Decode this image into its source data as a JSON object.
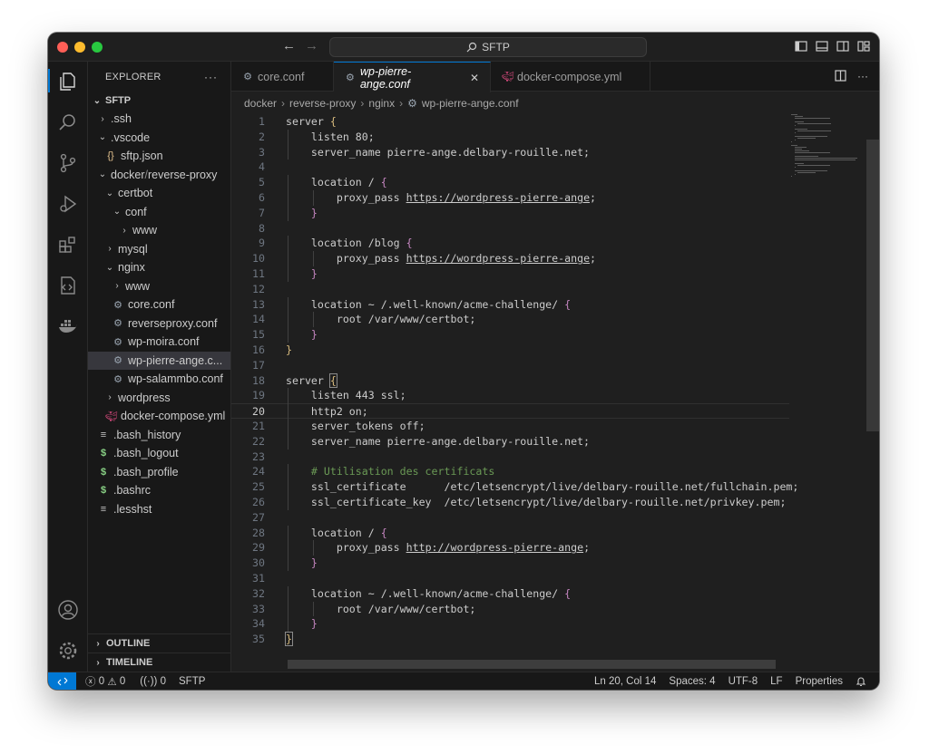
{
  "titlebar": {
    "search_text": "SFTP"
  },
  "explorer": {
    "header": "EXPLORER",
    "more": "···",
    "root": "SFTP",
    "items": [
      {
        "label": ".ssh",
        "kind": "folder",
        "open": false,
        "depth": 1
      },
      {
        "label": ".vscode",
        "kind": "folder",
        "open": true,
        "depth": 1
      },
      {
        "label": "sftp.json",
        "kind": "json",
        "depth": 2
      },
      {
        "label": "docker",
        "label2": "reverse-proxy",
        "kind": "folder",
        "open": true,
        "depth": 1
      },
      {
        "label": "certbot",
        "kind": "folder",
        "open": true,
        "depth": 2
      },
      {
        "label": "conf",
        "kind": "folder",
        "open": true,
        "depth": 3
      },
      {
        "label": "www",
        "kind": "folder",
        "open": false,
        "depth": 4
      },
      {
        "label": "mysql",
        "kind": "folder",
        "open": false,
        "depth": 2
      },
      {
        "label": "nginx",
        "kind": "folder",
        "open": true,
        "depth": 2
      },
      {
        "label": "www",
        "kind": "folder",
        "open": false,
        "depth": 3
      },
      {
        "label": "core.conf",
        "kind": "conf",
        "depth": 3
      },
      {
        "label": "reverseproxy.conf",
        "kind": "conf",
        "depth": 3
      },
      {
        "label": "wp-moira.conf",
        "kind": "conf",
        "depth": 3
      },
      {
        "label": "wp-pierre-ange.c...",
        "kind": "conf",
        "depth": 3,
        "selected": true
      },
      {
        "label": "wp-salammbo.conf",
        "kind": "conf",
        "depth": 3
      },
      {
        "label": "wordpress",
        "kind": "folder",
        "open": false,
        "depth": 2
      },
      {
        "label": "docker-compose.yml",
        "kind": "docker",
        "depth": 2
      },
      {
        "label": ".bash_history",
        "kind": "text",
        "depth": 1
      },
      {
        "label": ".bash_logout",
        "kind": "shell",
        "depth": 1
      },
      {
        "label": ".bash_profile",
        "kind": "shell",
        "depth": 1
      },
      {
        "label": ".bashrc",
        "kind": "shell",
        "depth": 1
      },
      {
        "label": ".lesshst",
        "kind": "text",
        "depth": 1
      }
    ],
    "outline": "OUTLINE",
    "timeline": "TIMELINE"
  },
  "tabs": [
    {
      "label": "core.conf",
      "icon": "gear-icon",
      "active": false
    },
    {
      "label": "wp-pierre-ange.conf",
      "icon": "gear-icon",
      "active": true,
      "close": "✕"
    },
    {
      "label": "docker-compose.yml",
      "icon": "docker-icon",
      "active": false
    }
  ],
  "breadcrumb": [
    "docker",
    "reverse-proxy",
    "nginx",
    "wp-pierre-ange.conf"
  ],
  "code": {
    "current_line": 20,
    "lines": [
      "server {",
      "    listen 80;",
      "    server_name pierre-ange.delbary-rouille.net;",
      "",
      "    location / {",
      "        proxy_pass https://wordpress-pierre-ange;",
      "    }",
      "",
      "    location /blog {",
      "        proxy_pass https://wordpress-pierre-ange;",
      "    }",
      "",
      "    location ~ /.well-known/acme-challenge/ {",
      "        root /var/www/certbot;",
      "    }",
      "}",
      "",
      "server {",
      "    listen 443 ssl;",
      "    http2 on;",
      "    server_tokens off;",
      "    server_name pierre-ange.delbary-rouille.net;",
      "",
      "    # Utilisation des certificats",
      "    ssl_certificate      /etc/letsencrypt/live/delbary-rouille.net/fullchain.pem;",
      "    ssl_certificate_key  /etc/letsencrypt/live/delbary-rouille.net/privkey.pem;",
      "",
      "    location / {",
      "        proxy_pass http://wordpress-pierre-ange;",
      "    }",
      "",
      "    location ~ /.well-known/acme-challenge/ {",
      "        root /var/www/certbot;",
      "    }",
      "}"
    ]
  },
  "status": {
    "errors": "0",
    "warnings": "0",
    "ports": "0",
    "remote_name": "SFTP",
    "position": "Ln 20, Col 14",
    "spaces": "Spaces: 4",
    "encoding": "UTF-8",
    "eol": "LF",
    "language": "Properties"
  },
  "colors": {
    "accent": "#0078d4",
    "bracket": "#d7ba7d",
    "bracket_inner": "#c586c0",
    "comment": "#6a9955"
  }
}
